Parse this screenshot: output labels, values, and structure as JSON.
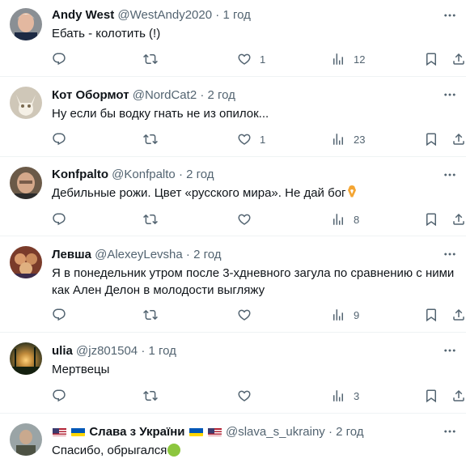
{
  "tweets": [
    {
      "name": "Andy West",
      "handle": "@WestAndy2020",
      "dot": "·",
      "time": "1 год",
      "text": "Ебать - колотить (!)",
      "replies": "",
      "retweets": "",
      "likes": "1",
      "views": "12"
    },
    {
      "name": "Кот Обормот",
      "handle": "@NordCat2",
      "dot": "·",
      "time": "2 год",
      "text": "Ну если бы водку гнать не из опилок...",
      "replies": "",
      "retweets": "",
      "likes": "1",
      "views": "23"
    },
    {
      "name": "Konfpalto",
      "handle": "@Konfpalto",
      "dot": "·",
      "time": "2 год",
      "text": "Дебильные рожи. Цвет «русского мира». Не дай бог",
      "replies": "",
      "retweets": "",
      "likes": "",
      "views": "8"
    },
    {
      "name": "Левша",
      "handle": "@AlexeyLevsha",
      "dot": "·",
      "time": "2 год",
      "text": "Я в понедельник утром после 3-хдневного загула по сравнению с ними как Ален Делон в молодости выгляжу",
      "replies": "",
      "retweets": "",
      "likes": "",
      "views": "9"
    },
    {
      "name": "ulia",
      "handle": "@jz801504",
      "dot": "·",
      "time": "1 год",
      "text": "Мертвецы",
      "replies": "",
      "retweets": "",
      "likes": "",
      "views": "3"
    },
    {
      "name": "Слава з України",
      "handle": "@slava_s_ukrainy",
      "dot": "·",
      "time": "2 год",
      "text": "Спасибо, обрыгался",
      "replies": "",
      "retweets": "",
      "likes": "",
      "views": ""
    }
  ],
  "icons": [
    "reply-icon",
    "retweet-icon",
    "like-icon",
    "views-icon",
    "bookmark-icon",
    "share-icon",
    "more-icon"
  ],
  "colors": {
    "text": "#0f1419",
    "secondary": "#536471",
    "divider": "#eff3f4"
  }
}
